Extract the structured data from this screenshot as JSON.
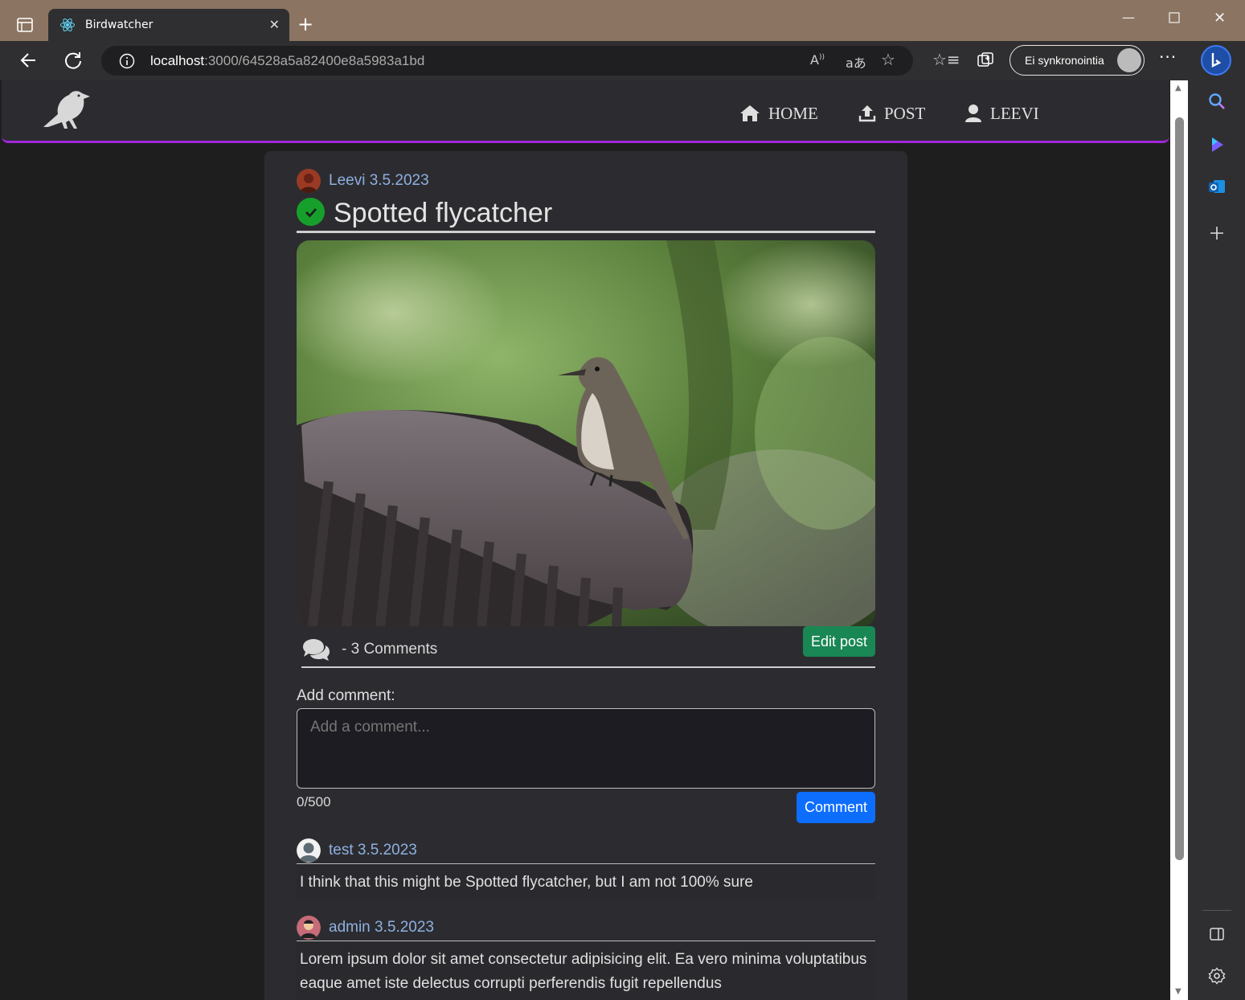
{
  "browser": {
    "tab_title": "Birdwatcher",
    "url_host": "localhost",
    "url_path": ":3000/64528a5a82400e8a5983a1bd",
    "profile_label": "Ei synkronointia",
    "icons": [
      "tab-actions-icon",
      "react-favicon-icon",
      "close-icon",
      "new-tab-icon",
      "back-icon",
      "refresh-icon",
      "info-icon",
      "read-aloud-icon",
      "translate-icon",
      "add-favorite-icon",
      "favorites-icon",
      "collections-icon",
      "more-icon",
      "bing-icon",
      "search-icon",
      "copilot-icon",
      "outlook-icon",
      "add-icon",
      "sidebar-panel-icon",
      "settings-icon"
    ]
  },
  "nav": {
    "home": "HOME",
    "post": "POST",
    "user": "LEEVI",
    "accent_color": "#a126d8"
  },
  "post": {
    "author": "Leevi",
    "date": "3.5.2023",
    "title": "Spotted flycatcher",
    "comments_count": "- 3 Comments",
    "edit_label": "Edit post"
  },
  "comment_form": {
    "label": "Add comment:",
    "placeholder": "Add a comment...",
    "counter": "0/500",
    "submit_label": "Comment"
  },
  "comments": [
    {
      "author": "test",
      "date": "3.5.2023",
      "text": "I think that this might be Spotted flycatcher, but I am not 100% sure"
    },
    {
      "author": "admin",
      "date": "3.5.2023",
      "text": "Lorem ipsum dolor sit amet consectetur adipisicing elit. Ea vero minima voluptatibus eaque amet iste delectus corrupti perferendis fugit repellendus"
    }
  ]
}
